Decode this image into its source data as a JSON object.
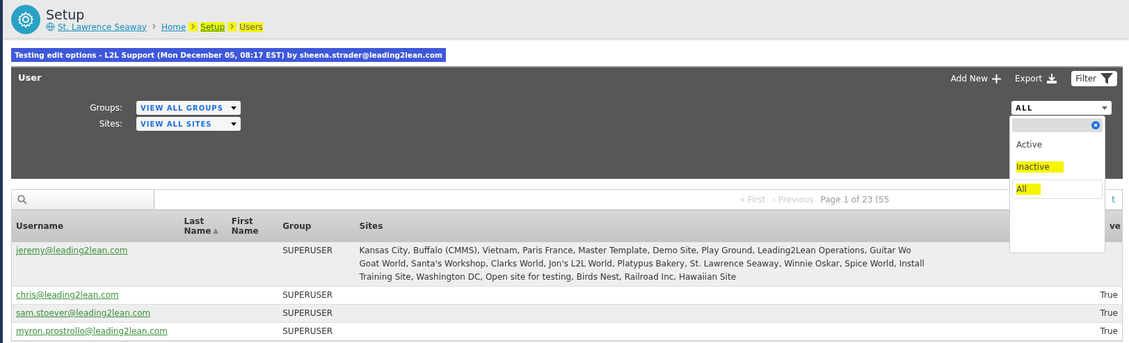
{
  "header": {
    "title": "Setup",
    "breadcrumb": [
      {
        "label": "St. Lawrence Seaway",
        "kind": "link",
        "highlighted": false
      },
      {
        "label": "Home",
        "kind": "link",
        "highlighted": false
      },
      {
        "label": "Setup",
        "kind": "link",
        "highlighted": true
      },
      {
        "label": "Users",
        "kind": "current",
        "highlighted": true
      }
    ]
  },
  "banner": "Testing edit options - L2L Support (Mon December 05, 08:17 EST) by sheena.strader@leading2lean.com",
  "panel": {
    "title": "User",
    "actions": [
      {
        "label": "Add New",
        "kind": "add"
      },
      {
        "label": "Export",
        "kind": "export"
      },
      {
        "label": "Filter",
        "kind": "filter"
      }
    ],
    "filters": [
      {
        "label": "Groups:",
        "value": "VIEW ALL GROUPS"
      },
      {
        "label": "Sites:",
        "value": "VIEW ALL SITES"
      }
    ],
    "status_select": {
      "value": "ALL",
      "options": [
        {
          "label": "Active",
          "selected": false,
          "highlighted": false
        },
        {
          "label": "Inactive",
          "selected": false,
          "highlighted": true
        },
        {
          "label": "All",
          "selected": true,
          "highlighted": true
        }
      ]
    }
  },
  "pager": {
    "first": "« First",
    "previous": "‹ Previous",
    "info": "Page 1 of 23 (55",
    "column_4": "t"
  },
  "table": {
    "columns": [
      "Username",
      "Last Name",
      "First Name",
      "Group",
      "Sites",
      "ve"
    ],
    "rows": [
      {
        "username": "jeremy@leading2lean.com",
        "group": "SUPERUSER",
        "sites": [
          "Kansas City, Buffalo (CMMS), Vietnam, Paris France, Master Template, Demo Site, Play Ground, Leading2Lean Operations, Guitar Wo",
          "Goat World, Santa's Workshop, Clarks World, Jon's L2L World, Platypus Bakery, St. Lawrence Seaway, Winnie Oskar, Spice World, Install",
          "Training Site, Washington DC, Open site for testing, Birds Nest, Railroad Inc, Hawaiian Site"
        ],
        "column_6": ""
      },
      {
        "username": "chris@leading2lean.com",
        "group": "SUPERUSER",
        "sites": [],
        "column_6": "True"
      },
      {
        "username": "sam.stoever@leading2lean.com",
        "group": "SUPERUSER",
        "sites": [],
        "column_6": "True"
      },
      {
        "username": "myron.prostrollo@leading2lean.com",
        "group": "SUPERUSER",
        "sites": [],
        "column_6": "True"
      }
    ]
  }
}
